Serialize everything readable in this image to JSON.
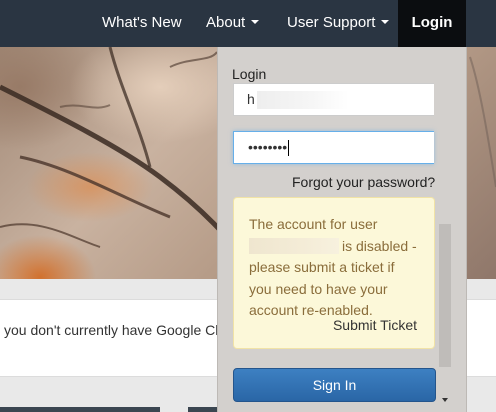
{
  "nav": {
    "whats_new": "What's New",
    "about": "About",
    "user_support": "User Support",
    "login": "Login"
  },
  "banner": {
    "text": "you don't currently have Google Ch"
  },
  "login_panel": {
    "label": "Login",
    "username_value": "h",
    "password_mask": "••••••••",
    "forgot_link": "Forgot your password?",
    "alert": {
      "line1": "The account for user",
      "line2_suffix": "is disabled -",
      "line3": "please submit a ticket if",
      "line4": "you need to have your",
      "line5": "account re-enabled.",
      "submit_ticket": "Submit Ticket"
    },
    "sign_in_button": "Sign In"
  },
  "colors": {
    "navbar": "#2a3542",
    "login_active": "#0b0d10",
    "alert_bg": "#fcf8d9",
    "alert_text": "#8a6d3b",
    "primary_button": "#2a66a6"
  }
}
